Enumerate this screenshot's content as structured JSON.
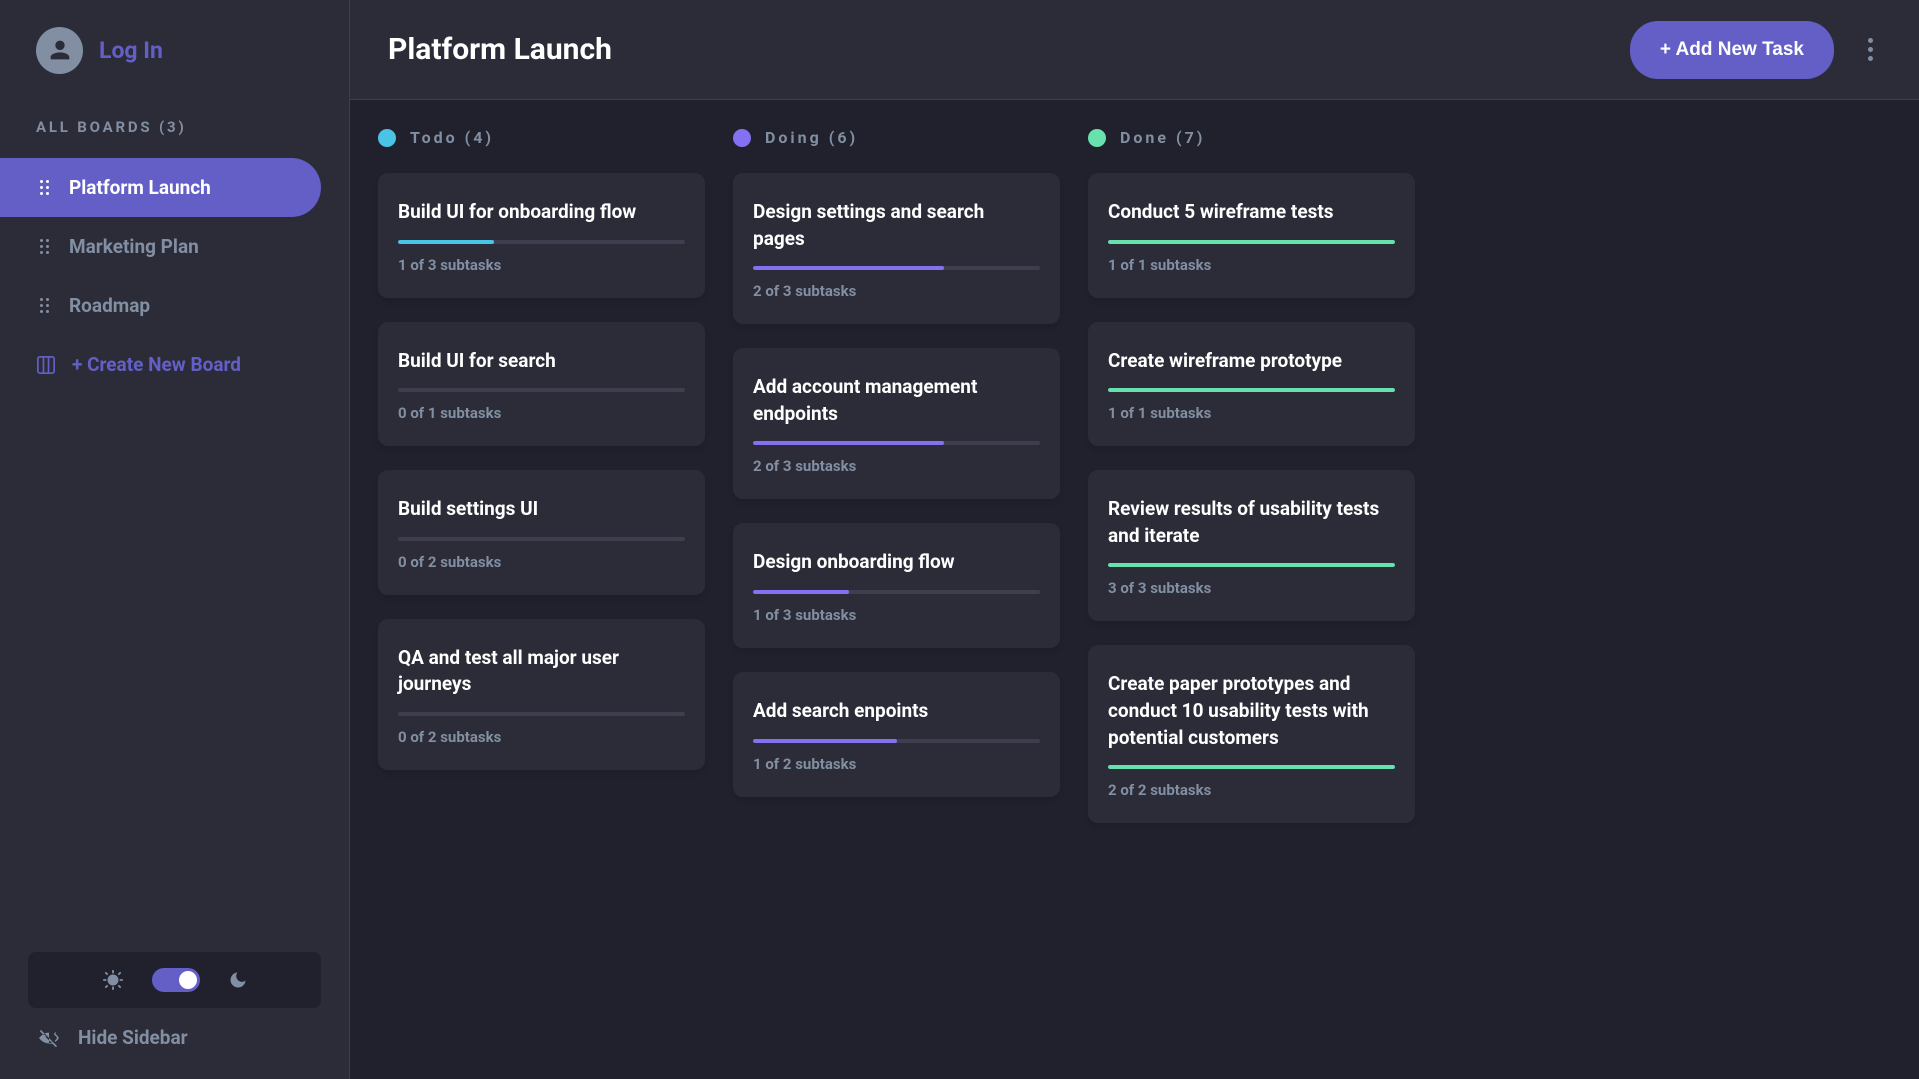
{
  "sidebar": {
    "login_label": "Log In",
    "all_boards_label": "ALL BOARDS (3)",
    "boards": [
      {
        "label": "Platform Launch",
        "active": true
      },
      {
        "label": "Marketing Plan",
        "active": false
      },
      {
        "label": "Roadmap",
        "active": false
      }
    ],
    "create_board_label": "+ Create New Board",
    "hide_sidebar_label": "Hide Sidebar"
  },
  "header": {
    "title": "Platform Launch",
    "add_task_label": "+ Add New Task"
  },
  "columns": [
    {
      "title": "Todo (4)",
      "color": "#49c4e5",
      "tasks": [
        {
          "title": "Build UI for onboarding flow",
          "done": 1,
          "total": 3,
          "subtask_label": "1 of 3 subtasks"
        },
        {
          "title": "Build UI for search",
          "done": 0,
          "total": 1,
          "subtask_label": "0 of 1 subtasks"
        },
        {
          "title": "Build settings UI",
          "done": 0,
          "total": 2,
          "subtask_label": "0 of 2 subtasks"
        },
        {
          "title": "QA and test all major user journeys",
          "done": 0,
          "total": 2,
          "subtask_label": "0 of 2 subtasks"
        }
      ]
    },
    {
      "title": "Doing (6)",
      "color": "#8471f2",
      "tasks": [
        {
          "title": "Design settings and search pages",
          "done": 2,
          "total": 3,
          "subtask_label": "2 of 3 subtasks"
        },
        {
          "title": "Add account management endpoints",
          "done": 2,
          "total": 3,
          "subtask_label": "2 of 3 subtasks"
        },
        {
          "title": "Design onboarding flow",
          "done": 1,
          "total": 3,
          "subtask_label": "1 of 3 subtasks"
        },
        {
          "title": "Add search enpoints",
          "done": 1,
          "total": 2,
          "subtask_label": "1 of 2 subtasks"
        }
      ]
    },
    {
      "title": "Done (7)",
      "color": "#67e2ae",
      "tasks": [
        {
          "title": "Conduct 5 wireframe tests",
          "done": 1,
          "total": 1,
          "subtask_label": "1 of 1 subtasks"
        },
        {
          "title": "Create wireframe prototype",
          "done": 1,
          "total": 1,
          "subtask_label": "1 of 1 subtasks"
        },
        {
          "title": "Review results of usability tests and iterate",
          "done": 3,
          "total": 3,
          "subtask_label": "3 of 3 subtasks"
        },
        {
          "title": "Create paper prototypes and conduct 10 usability tests with potential customers",
          "done": 2,
          "total": 2,
          "subtask_label": "2 of 2 subtasks"
        }
      ]
    }
  ]
}
